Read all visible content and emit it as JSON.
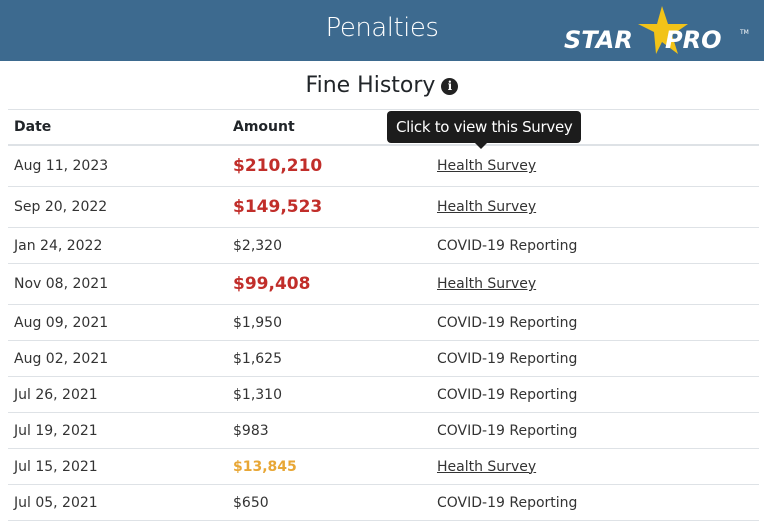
{
  "header": {
    "title": "Penalties",
    "logo_text": "STAR PRO",
    "colors": {
      "bar": "#3d6a8f",
      "star": "#f2c318"
    }
  },
  "section": {
    "title": "Fine History",
    "info_icon": "info-circle-icon"
  },
  "table": {
    "columns": [
      "Date",
      "Amount",
      ""
    ],
    "rows": [
      {
        "date": "Aug 11, 2023",
        "amount": "$210,210",
        "type": "Health Survey",
        "style": "red",
        "link": true
      },
      {
        "date": "Sep 20, 2022",
        "amount": "$149,523",
        "type": "Health Survey",
        "style": "red",
        "link": true
      },
      {
        "date": "Jan 24, 2022",
        "amount": "$2,320",
        "type": "COVID-19 Reporting",
        "style": "normal",
        "link": false
      },
      {
        "date": "Nov 08, 2021",
        "amount": "$99,408",
        "type": "Health Survey",
        "style": "red",
        "link": true
      },
      {
        "date": "Aug 09, 2021",
        "amount": "$1,950",
        "type": "COVID-19 Reporting",
        "style": "normal",
        "link": false
      },
      {
        "date": "Aug 02, 2021",
        "amount": "$1,625",
        "type": "COVID-19 Reporting",
        "style": "normal",
        "link": false
      },
      {
        "date": "Jul 26, 2021",
        "amount": "$1,310",
        "type": "COVID-19 Reporting",
        "style": "normal",
        "link": false
      },
      {
        "date": "Jul 19, 2021",
        "amount": "$983",
        "type": "COVID-19 Reporting",
        "style": "normal",
        "link": false
      },
      {
        "date": "Jul 15, 2021",
        "amount": "$13,845",
        "type": "Health Survey",
        "style": "gold",
        "link": true
      },
      {
        "date": "Jul 05, 2021",
        "amount": "$650",
        "type": "COVID-19 Reporting",
        "style": "normal",
        "link": false
      }
    ]
  },
  "tooltip": {
    "text": "Click to view this Survey"
  }
}
